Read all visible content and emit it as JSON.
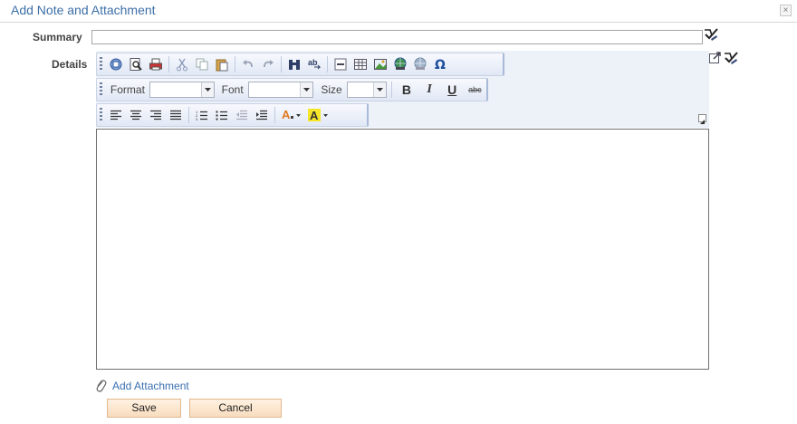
{
  "window": {
    "title": "Add Note and Attachment",
    "close_glyph": "×"
  },
  "form": {
    "summary_label": "Summary",
    "summary_value": "",
    "details_label": "Details",
    "details_value": ""
  },
  "toolbar": {
    "format_label": "Format",
    "font_label": "Font",
    "size_label": "Size",
    "format_value": "",
    "font_value": "",
    "size_value": "",
    "bold_glyph": "B",
    "italic_glyph": "I",
    "underline_glyph": "U",
    "strike_glyph": "abc"
  },
  "actions": {
    "add_attachment": "Add Attachment",
    "save": "Save",
    "cancel": "Cancel"
  },
  "colors": {
    "title": "#3c6fa8",
    "link": "#3a6fb0",
    "button_bg": "#f8dcbd",
    "toolbar_bg": "#edf1f8"
  }
}
